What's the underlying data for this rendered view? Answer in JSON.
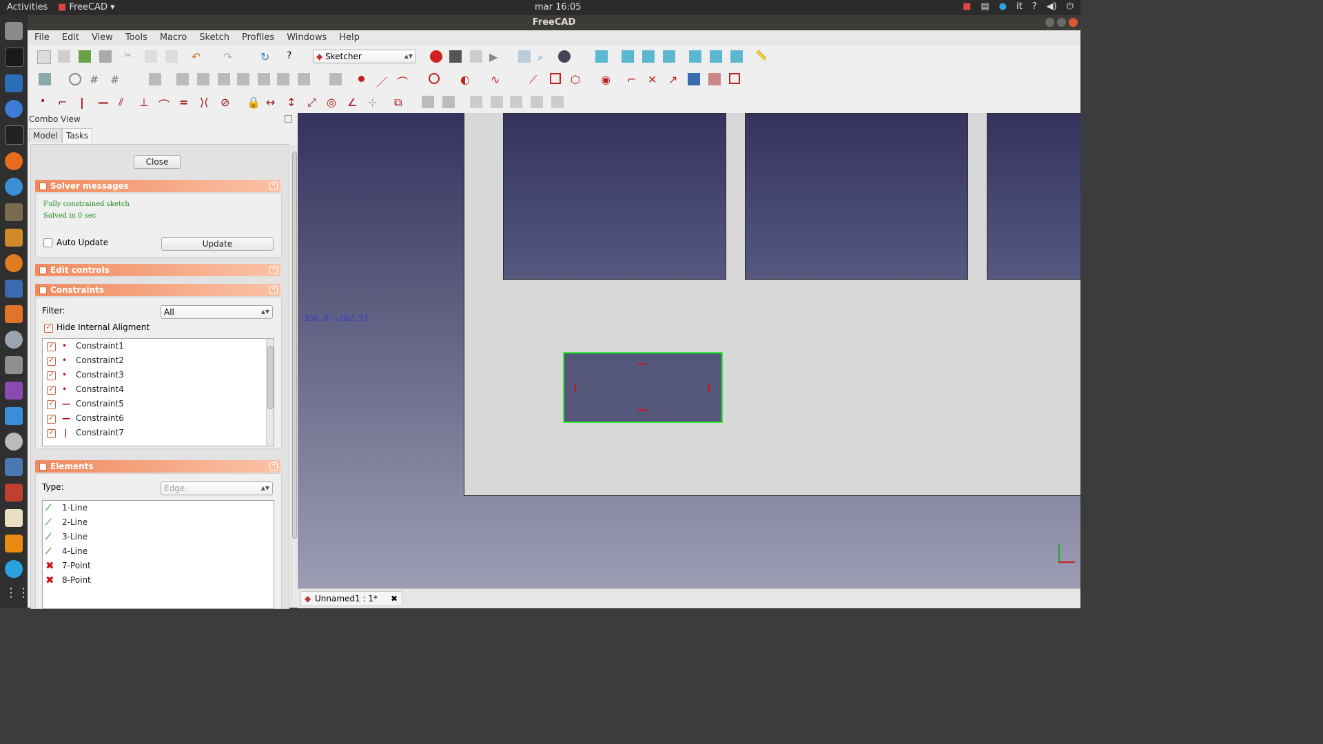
{
  "topbar": {
    "activities": "Activities",
    "app_name": "FreeCAD",
    "clock": "mar 16:05",
    "lang": "it",
    "help": "?"
  },
  "window": {
    "title": "FreeCAD"
  },
  "menu": [
    "File",
    "Edit",
    "View",
    "Tools",
    "Macro",
    "Sketch",
    "Profiles",
    "Windows",
    "Help"
  ],
  "toolbar": {
    "workbench": "Sketcher"
  },
  "combo": {
    "title": "Combo View",
    "tabs": [
      "Model",
      "Tasks"
    ],
    "close": "Close"
  },
  "solver": {
    "header": "Solver messages",
    "msg1": "Fully constrained sketch",
    "msg2": "Solved in 0 sec",
    "auto_update": "Auto Update",
    "auto_update_checked": false,
    "update": "Update"
  },
  "edit_controls": {
    "header": "Edit controls"
  },
  "constraints": {
    "header": "Constraints",
    "filter_label": "Filter:",
    "filter_value": "All",
    "hide_internal": "Hide Internal Aligment",
    "hide_internal_checked": true,
    "items": [
      {
        "name": "Constraint1",
        "icon": "coincident-icon"
      },
      {
        "name": "Constraint2",
        "icon": "coincident-icon"
      },
      {
        "name": "Constraint3",
        "icon": "coincident-icon"
      },
      {
        "name": "Constraint4",
        "icon": "coincident-icon"
      },
      {
        "name": "Constraint5",
        "icon": "horizontal-icon"
      },
      {
        "name": "Constraint6",
        "icon": "horizontal-icon"
      },
      {
        "name": "Constraint7",
        "icon": "vertical-icon"
      }
    ]
  },
  "elements": {
    "header": "Elements",
    "type_label": "Type:",
    "type_value": "Edge",
    "items": [
      {
        "name": "1-Line",
        "icon": "line-icon"
      },
      {
        "name": "2-Line",
        "icon": "line-icon"
      },
      {
        "name": "3-Line",
        "icon": "line-icon"
      },
      {
        "name": "4-Line",
        "icon": "line-icon"
      },
      {
        "name": "7-Point",
        "icon": "point-cross-icon"
      },
      {
        "name": "8-Point",
        "icon": "point-cross-icon"
      }
    ]
  },
  "viewport": {
    "coord": "-350.0,-262.5)"
  },
  "doc_tab": {
    "label": "Unnamed1 : 1*"
  },
  "colors": {
    "solver_ok": "#1b8b1b",
    "section_header": "#f08a5e",
    "selection": "#33ee33"
  }
}
